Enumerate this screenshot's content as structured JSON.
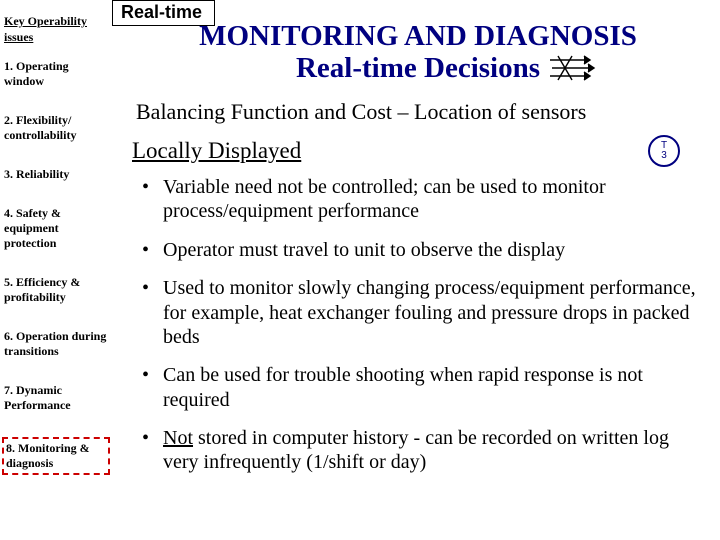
{
  "tab": {
    "label": "Real-time"
  },
  "sidebar": {
    "title": "Key Operability issues",
    "items": [
      {
        "label": "1. Operating window"
      },
      {
        "label": "2. Flexibility/ controllability"
      },
      {
        "label": "3. Reliability"
      },
      {
        "label": "4. Safety & equipment protection"
      },
      {
        "label": "5. Efficiency & profitability"
      },
      {
        "label": "6. Operation during transitions"
      },
      {
        "label": "7. Dynamic Performance"
      },
      {
        "label": "8. Monitoring & diagnosis"
      }
    ],
    "active_index": 7
  },
  "title": {
    "line1": "MONITORING AND DIAGNOSIS",
    "line2": "Real-time Decisions"
  },
  "subtitle": "Balancing Function and Cost – Location of sensors",
  "section": {
    "heading": "Locally Displayed"
  },
  "sensor_bubble": {
    "line1": "T",
    "line2": "3"
  },
  "bullets": [
    {
      "text": "Variable need not be controlled; can be used to monitor process/equipment performance"
    },
    {
      "text": "Operator must travel to unit to observe the display"
    },
    {
      "text": "Used to monitor slowly changing process/equipment performance, for example, heat exchanger fouling and pressure drops in packed beds"
    },
    {
      "text": "Can be used for trouble shooting when rapid response is not required"
    },
    {
      "prefix_u": "Not",
      "rest": " stored in computer history - can be recorded on written log very infrequently (1/shift or day)"
    }
  ]
}
